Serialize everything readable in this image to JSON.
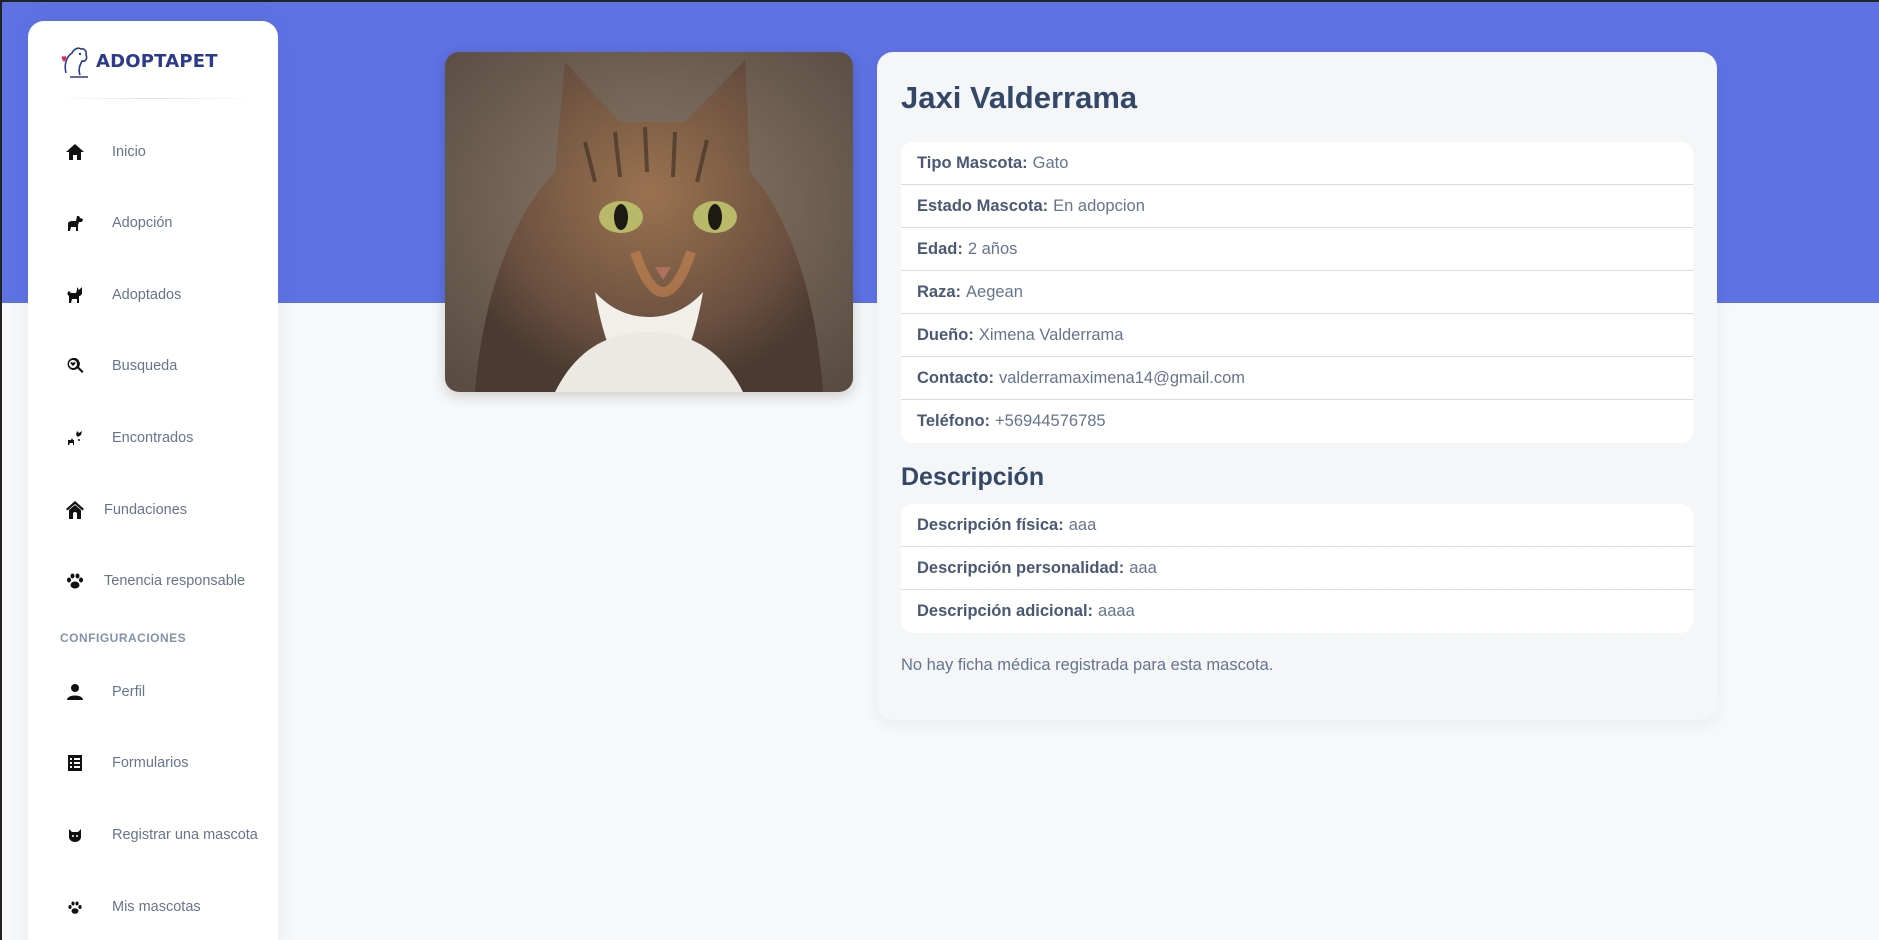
{
  "brand": {
    "name": "ADOPTAPET"
  },
  "sidebar": {
    "items": [
      {
        "label": "Inicio",
        "icon": "home-icon"
      },
      {
        "label": "Adopción",
        "icon": "dog-icon"
      },
      {
        "label": "Adoptados",
        "icon": "cat-icon"
      },
      {
        "label": "Busqueda",
        "icon": "search-heart-icon"
      },
      {
        "label": "Encontrados",
        "icon": "dog-cat-icon"
      },
      {
        "label": "Fundaciones",
        "icon": "house-icon"
      },
      {
        "label": "Tenencia responsable",
        "icon": "paw-icon"
      }
    ],
    "section_title": "CONFIGURACIONES",
    "config_items": [
      {
        "label": "Perfil",
        "icon": "user-icon"
      },
      {
        "label": "Formularios",
        "icon": "form-icon"
      },
      {
        "label": "Registrar una mascota",
        "icon": "cat-face-icon"
      },
      {
        "label": "Mis mascotas",
        "icon": "paw-icon"
      }
    ]
  },
  "pet": {
    "name": "Jaxi Valderrama",
    "details": [
      {
        "label": "Tipo Mascota:",
        "value": "Gato"
      },
      {
        "label": "Estado Mascota:",
        "value": "En adopcion"
      },
      {
        "label": "Edad:",
        "value": "2 años"
      },
      {
        "label": "Raza:",
        "value": "Aegean"
      },
      {
        "label": "Dueño:",
        "value": "Ximena Valderrama"
      },
      {
        "label": "Contacto:",
        "value": "valderramaximena14@gmail.com"
      },
      {
        "label": "Teléfono:",
        "value": "+56944576785"
      }
    ],
    "description_heading": "Descripción",
    "descriptions": [
      {
        "label": "Descripción física:",
        "value": "aaa"
      },
      {
        "label": "Descripción personalidad:",
        "value": "aaa"
      },
      {
        "label": "Descripción adicional:",
        "value": "aaaa"
      }
    ],
    "medical_note": "No hay ficha médica registrada para esta mascota."
  },
  "colors": {
    "hero": "#5e72e4",
    "brand": "#2b3a8c",
    "text_muted": "#67748e",
    "heading": "#344767"
  }
}
